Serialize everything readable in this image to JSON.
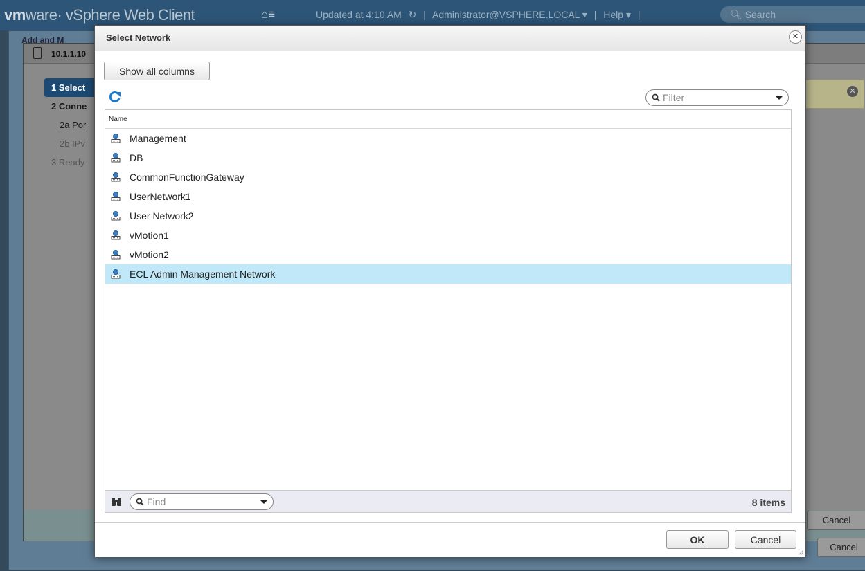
{
  "app": {
    "logo_vm": "vm",
    "logo_rest": "ware· vSphere Web Client",
    "home_glyph": "⌂≡",
    "updated": "Updated at 4:10 AM",
    "refresh_glyph": "↻",
    "user": "Administrator@VSPHERE.LOCAL ▾",
    "help": "Help ▾",
    "search_placeholder": "Search"
  },
  "background": {
    "wizard_title": "Add and M",
    "host": "10.1.1.10",
    "steps": [
      "1  Select",
      "2  Conne",
      "2a  Por",
      "2b  IPv",
      "3  Ready"
    ],
    "cancel1": "Cancel",
    "cancel2": "Cancel"
  },
  "dialog": {
    "title": "Select Network",
    "close_glyph": "✕",
    "show_all_columns": "Show all columns",
    "filter_placeholder": "Filter",
    "column_name": "Name",
    "rows": [
      {
        "name": "Management"
      },
      {
        "name": "DB"
      },
      {
        "name": "CommonFunctionGateway"
      },
      {
        "name": "UserNetwork1"
      },
      {
        "name": "User Network2"
      },
      {
        "name": "vMotion1"
      },
      {
        "name": "vMotion2"
      },
      {
        "name": "ECL Admin Management Network"
      }
    ],
    "selected_index": 7,
    "find_placeholder": "Find",
    "item_count": "8 items",
    "ok": "OK",
    "cancel": "Cancel"
  },
  "colors": {
    "selection": "#c0e8f8",
    "refresh_blue": "#1a7cd0",
    "header_bar": "#2d5577"
  }
}
